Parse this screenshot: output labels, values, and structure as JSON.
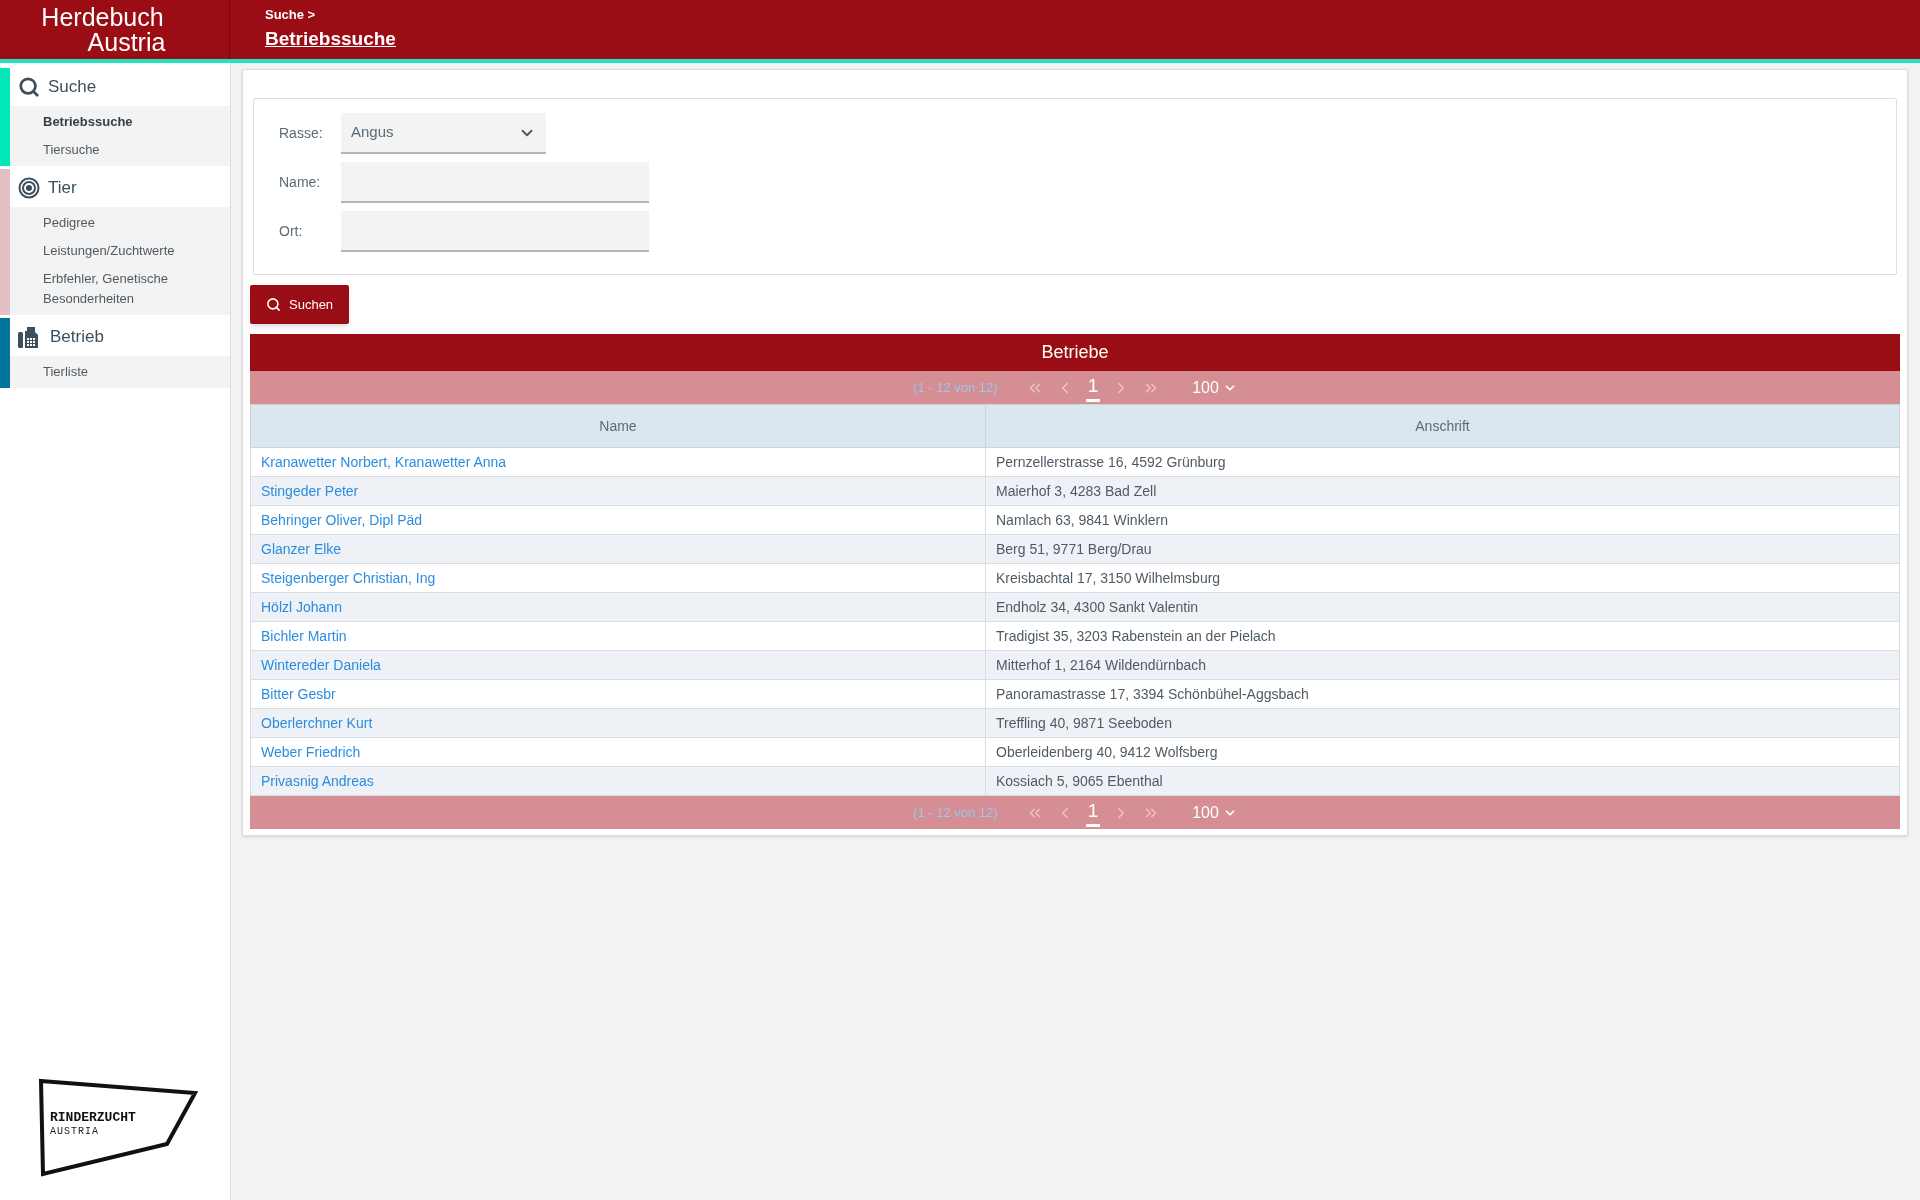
{
  "header": {
    "logo_lines": [
      "Herdebuch",
      "Austria"
    ],
    "breadcrumb": "Suche >",
    "page_title": "Betriebssuche"
  },
  "sidebar": {
    "sections": [
      {
        "title": "Suche",
        "kind": "search",
        "color": "#00e8b8",
        "items": [
          {
            "label": "Betriebssuche",
            "selected": true
          },
          {
            "label": "Tiersuche",
            "selected": false
          }
        ]
      },
      {
        "title": "Tier",
        "kind": "target",
        "color": "#e2c0c4",
        "items": [
          {
            "label": "Pedigree",
            "selected": false
          },
          {
            "label": "Leistungen/Zuchtwerte",
            "selected": false
          },
          {
            "label": "Erbfehler, Genetische Besonderheiten",
            "selected": false
          }
        ]
      },
      {
        "title": "Betrieb",
        "kind": "fax",
        "color": "#00739e",
        "items": [
          {
            "label": "Tierliste",
            "selected": false
          }
        ]
      }
    ]
  },
  "footer_logo": {
    "lines": [
      "RINDERZUCHT",
      "AUSTRIA"
    ]
  },
  "form": {
    "fields": [
      {
        "label": "Rasse:",
        "kind": "select",
        "value": "Angus"
      },
      {
        "label": "Name:",
        "kind": "text"
      },
      {
        "label": "Ort:",
        "kind": "text"
      }
    ],
    "button": "Suchen"
  },
  "table": {
    "title": "Betriebe",
    "pagers": [
      {
        "range": "(1 - 12 von 12)",
        "page": "1",
        "page_size": "100"
      },
      {
        "range": "(1 - 12 von 12)",
        "page": "1",
        "page_size": "100"
      }
    ],
    "columns": [
      "Name",
      "Anschrift"
    ],
    "rows": [
      {
        "name": "Kranawetter Norbert, Kranawetter Anna",
        "address": "Pernzellerstrasse 16, 4592 Grünburg"
      },
      {
        "name": "Stingeder Peter",
        "address": "Maierhof 3, 4283 Bad Zell"
      },
      {
        "name": "Behringer Oliver, Dipl Päd",
        "address": "Namlach 63, 9841 Winklern"
      },
      {
        "name": "Glanzer Elke",
        "address": "Berg 51, 9771 Berg/Drau"
      },
      {
        "name": "Steigenberger Christian, Ing",
        "address": "Kreisbachtal 17, 3150 Wilhelmsburg"
      },
      {
        "name": "Hölzl Johann",
        "address": "Endholz 34, 4300 Sankt Valentin"
      },
      {
        "name": "Bichler Martin",
        "address": "Tradigist 35, 3203 Rabenstein an der Pielach"
      },
      {
        "name": "Wintereder Daniela",
        "address": "Mitterhof 1, 2164 Wildendürnbach"
      },
      {
        "name": "Bitter Gesbr",
        "address": "Panoramastrasse 17, 3394 Schönbühel-Aggsbach"
      },
      {
        "name": "Oberlerchner Kurt",
        "address": "Treffling 40, 9871 Seeboden"
      },
      {
        "name": "Weber Friedrich",
        "address": "Oberleidenberg 40, 9412 Wolfsberg"
      },
      {
        "name": "Privasnig Andreas",
        "address": "Kossiach 5, 9065 Ebenthal"
      }
    ]
  }
}
